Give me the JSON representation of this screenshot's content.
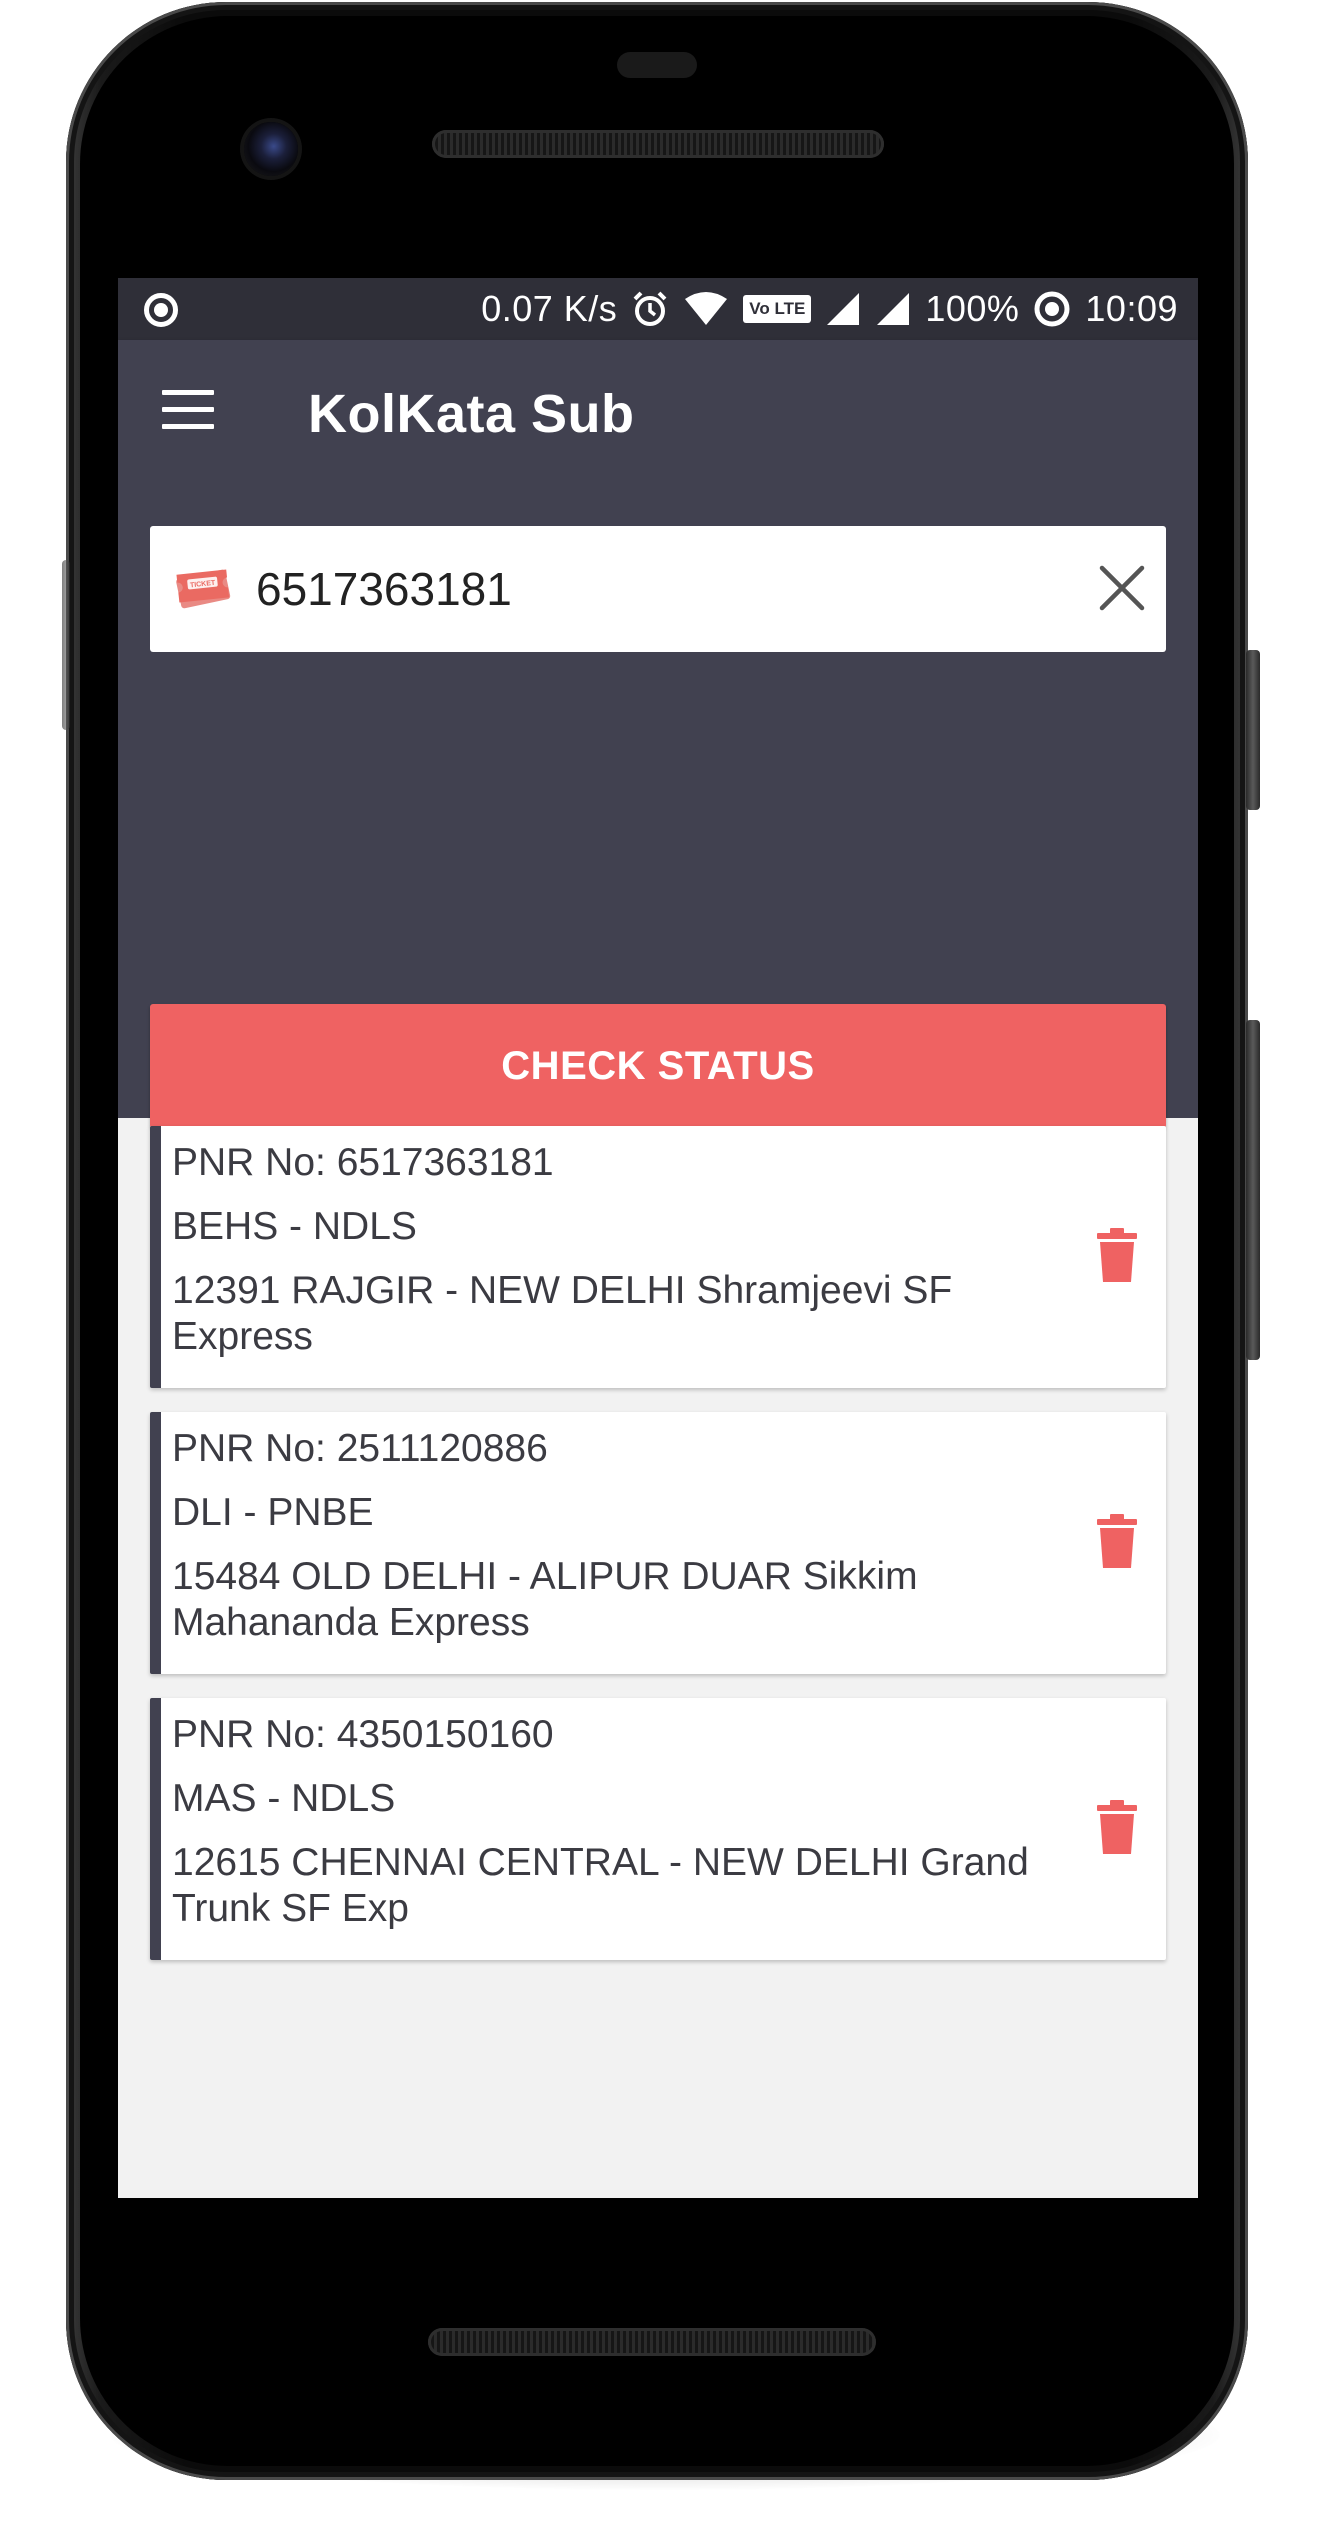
{
  "status_bar": {
    "speed": "0.07 K/s",
    "volte": "Vo LTE",
    "battery": "100%",
    "time": "10:09",
    "icons": [
      "record-icon",
      "alarm-icon",
      "wifi-icon",
      "volte-icon",
      "signal-icon",
      "signal-icon",
      "battery-saver-icon"
    ]
  },
  "app_bar": {
    "title": "KolKata Sub",
    "menu_icon": "hamburger-menu-icon"
  },
  "search": {
    "value": "6517363181",
    "icon": "ticket-icon",
    "ticket_label": "TICKET",
    "clear_icon": "close-icon"
  },
  "check_button": {
    "label": "CHECK STATUS",
    "color": "#ef6262"
  },
  "colors": {
    "header": "#414150",
    "status_bar": "#2f2f38",
    "accent": "#ef6262",
    "list_background": "#f2f2f2"
  },
  "history": [
    {
      "pnr": "PNR No: 6517363181",
      "route": "BEHS - NDLS",
      "train": "12391  RAJGIR - NEW DELHI Shramjeevi SF Express",
      "delete_icon": "trash-icon"
    },
    {
      "pnr": "PNR No: 2511120886",
      "route": "DLI - PNBE",
      "train": "15484  OLD DELHI - ALIPUR DUAR Sikkim Mahananda Express",
      "delete_icon": "trash-icon"
    },
    {
      "pnr": "PNR No: 4350150160",
      "route": "MAS - NDLS",
      "train": "12615  CHENNAI CENTRAL - NEW DELHI Grand Trunk SF Exp",
      "delete_icon": "trash-icon"
    }
  ]
}
